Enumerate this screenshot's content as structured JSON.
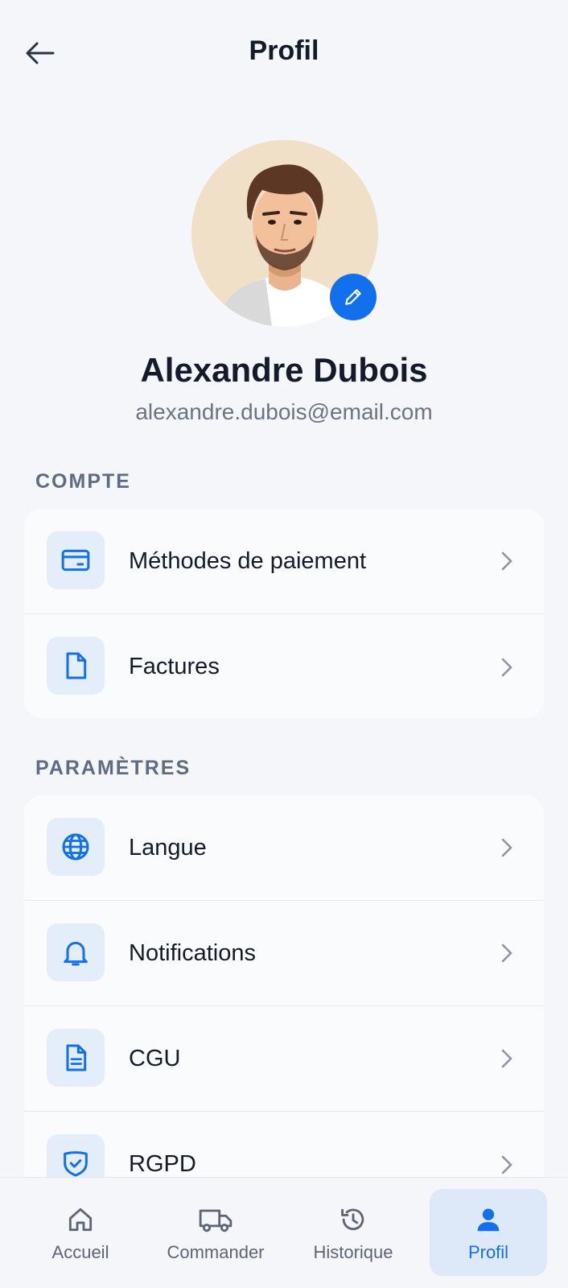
{
  "header": {
    "title": "Profil",
    "back_icon": "arrow-left-icon"
  },
  "profile": {
    "name": "Alexandre Dubois",
    "email": "alexandre.dubois@email.com",
    "edit_icon": "pencil-icon"
  },
  "sections": {
    "account": {
      "label": "COMPTE",
      "items": [
        {
          "label": "Méthodes de paiement",
          "icon": "credit-card-icon"
        },
        {
          "label": "Factures",
          "icon": "document-icon"
        }
      ]
    },
    "settings": {
      "label": "PARAMÈTRES",
      "items": [
        {
          "label": "Langue",
          "icon": "globe-icon"
        },
        {
          "label": "Notifications",
          "icon": "bell-icon"
        },
        {
          "label": "CGU",
          "icon": "document-text-icon"
        },
        {
          "label": "RGPD",
          "icon": "shield-check-icon"
        }
      ]
    }
  },
  "nav": {
    "items": [
      {
        "label": "Accueil",
        "icon": "home-icon",
        "active": false
      },
      {
        "label": "Commander",
        "icon": "truck-icon",
        "active": false
      },
      {
        "label": "Historique",
        "icon": "history-icon",
        "active": false
      },
      {
        "label": "Profil",
        "icon": "user-icon",
        "active": true
      }
    ]
  },
  "colors": {
    "accent": "#1370ec",
    "background": "#f4f6f9",
    "icon_bg": "#e4edfa"
  }
}
